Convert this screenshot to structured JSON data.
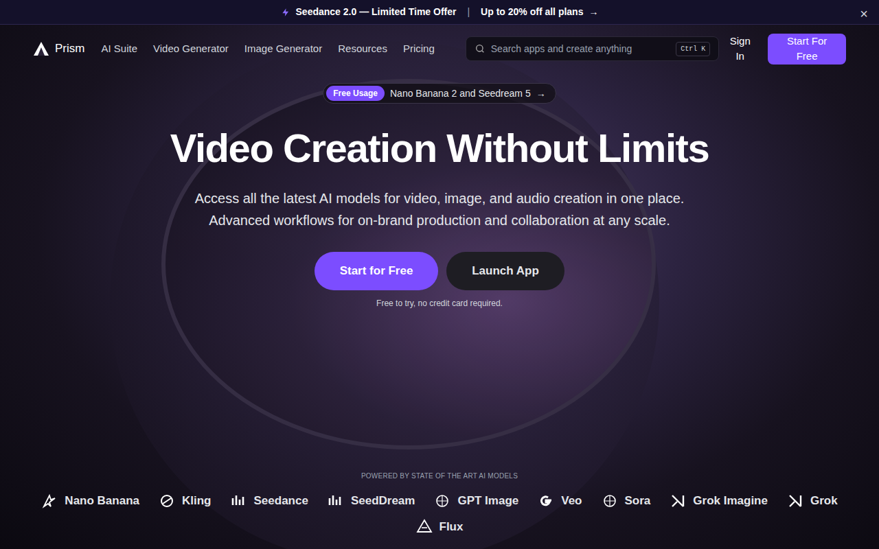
{
  "banner": {
    "text": "Seedance 2.0 — Limited Time Offer",
    "separator": "|",
    "offer": "Up to 20% off all plans",
    "arrow": "→",
    "close": "×"
  },
  "nav": {
    "logo": "Prism",
    "links": [
      "AI Suite",
      "Video Generator",
      "Image Generator",
      "Resources",
      "Pricing"
    ],
    "search": {
      "placeholder": "Search apps and create anything",
      "shortcut": "Ctrl K"
    },
    "sign_in": "Sign In",
    "cta": "Start For Free"
  },
  "hero": {
    "badge": {
      "label": "Free Usage",
      "text": "Nano Banana 2 and Seedream 5",
      "arrow": "→"
    },
    "title": "Video Creation Without Limits",
    "subtitle": [
      "Access all the latest AI models for video, image, and audio creation in one place.",
      "Advanced workflows for on-brand production and collaboration at any scale."
    ],
    "buttons": [
      "Start for Free",
      "Launch App"
    ],
    "note": "Free to try, no credit card required."
  },
  "models": {
    "caption": "POWERED BY STATE OF THE ART AI MODELS",
    "items": [
      "Nano Banana",
      "Kling",
      "Seedance",
      "SeedDream",
      "GPT Image",
      "Veo",
      "Sora",
      "Grok Imagine",
      "Grok",
      "Flux"
    ]
  }
}
